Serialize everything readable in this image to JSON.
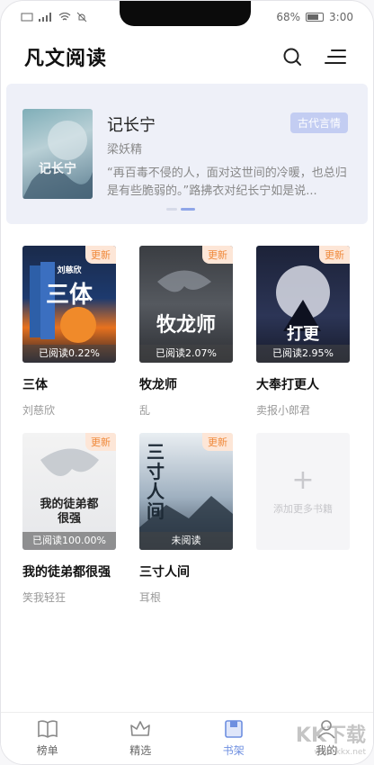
{
  "status_bar": {
    "battery_pct": "68%",
    "time": "3:00"
  },
  "header": {
    "title": "凡文阅读",
    "search_icon": "search-icon",
    "menu_icon": "menu-icon"
  },
  "banner": {
    "title": "记长宁",
    "author": "梁妖精",
    "tag": "古代言情",
    "description": "“再百毒不侵的人，面对这世间的冷暖，也总归是有些脆弱的。”路拂衣对纪长宁如是说...",
    "cover_text": "记长宁"
  },
  "books": [
    {
      "title": "三体",
      "author": "刘慈欣",
      "badge": "更新",
      "progress": "已阅读0.22%",
      "cover_text": "三体",
      "cover_sub": "刘慈欣"
    },
    {
      "title": "牧龙师",
      "author": "乱",
      "badge": "更新",
      "progress": "已阅读2.07%",
      "cover_text": "牧龙师"
    },
    {
      "title": "大奉打更人",
      "author": "卖报小郎君",
      "badge": "更新",
      "progress": "已阅读2.95%",
      "cover_text": "打更"
    },
    {
      "title": "我的徒弟都很强",
      "author": "笑我轻狂",
      "badge": "更新",
      "progress": "已阅读100.00%",
      "cover_text": "我的徒弟都很强"
    },
    {
      "title": "三寸人间",
      "author": "耳根",
      "badge": "更新",
      "progress": "未阅读",
      "cover_text": "三寸人间"
    }
  ],
  "add_card": {
    "label": "添加更多书籍",
    "plus": "+"
  },
  "nav": [
    {
      "label": "榜单",
      "icon": "book-icon"
    },
    {
      "label": "精选",
      "icon": "crown-icon"
    },
    {
      "label": "书架",
      "icon": "bookshelf-icon",
      "active": true
    },
    {
      "label": "我的",
      "icon": "user-icon"
    }
  ],
  "watermark": {
    "text": "KK下载",
    "url": "www.kkx.net"
  },
  "colors": {
    "accent": "#6e8fe0",
    "badge_bg": "#fde6d7",
    "badge_text": "#f08a3c",
    "banner_bg": "#eef0f8"
  }
}
